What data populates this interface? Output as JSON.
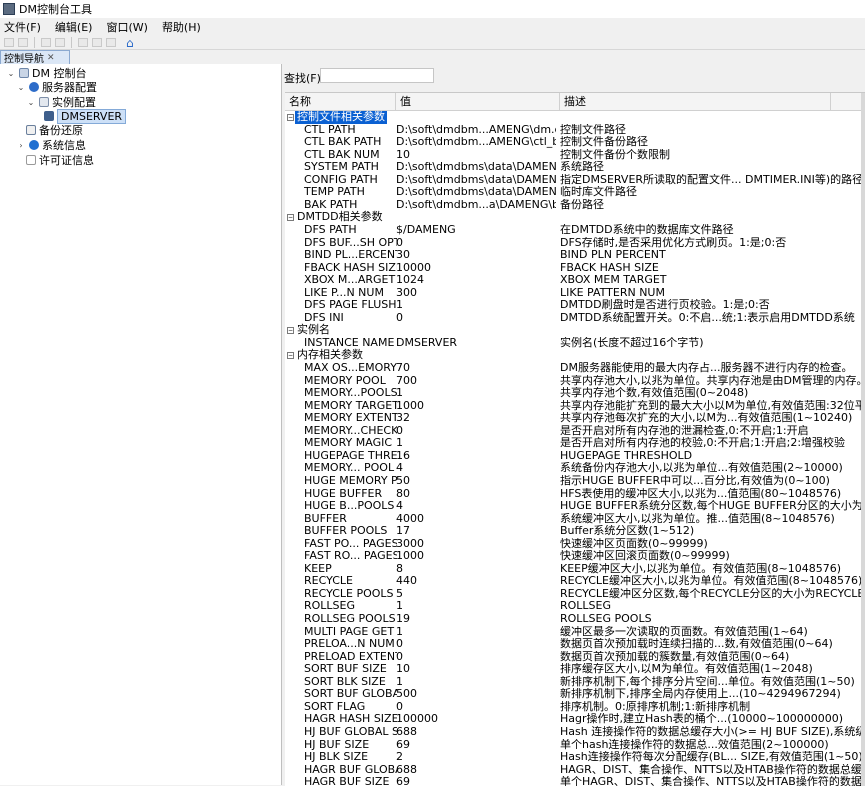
{
  "window": {
    "title": "DM控制台工具",
    "icon": "app-icon"
  },
  "menu": [
    "文件(F)",
    "编辑(E)",
    "窗口(W)",
    "帮助(H)"
  ],
  "toolbar_icons": [
    "new-icon",
    "save-icon",
    "back-icon",
    "forward-icon",
    "cut-icon",
    "copy-icon",
    "paste-icon",
    "home-icon"
  ],
  "panel": {
    "tab_label": "控制导航",
    "close_glyph": "✕"
  },
  "tree": [
    {
      "label": "DM 控制台",
      "icon": "db-icon",
      "level": 0,
      "expanded": true
    },
    {
      "label": "服务器配置",
      "icon": "gear-icon",
      "level": 1,
      "expanded": true
    },
    {
      "label": "实例配置",
      "icon": "doc-icon",
      "level": 2,
      "expanded": true
    },
    {
      "label": "DMSERVER",
      "icon": "server-icon",
      "level": 3,
      "selected": true
    },
    {
      "label": "备份还原",
      "icon": "backup-icon",
      "level": 1
    },
    {
      "label": "系统信息",
      "icon": "info-icon",
      "level": 1,
      "collapsed": true
    },
    {
      "label": "许可证信息",
      "icon": "license-icon",
      "level": 1
    }
  ],
  "search": {
    "label": "查找(F):",
    "value": ""
  },
  "table": {
    "headers": [
      "名称",
      "值",
      "描述"
    ],
    "rows": [
      {
        "group": "控制文件相关参数",
        "highlight": true
      },
      {
        "name": "CTL PATH",
        "value": "D:\\soft\\dmdbm...AMENG\\dm.ctl",
        "desc": "控制文件路径"
      },
      {
        "name": "CTL BAK PATH",
        "value": "D:\\soft\\dmdbm...AMENG\\ctl_bak",
        "desc": "控制文件备份路径"
      },
      {
        "name": "CTL BAK NUM",
        "value": "10",
        "desc": "控制文件备份个数限制"
      },
      {
        "name": "SYSTEM PATH",
        "value": "D:\\soft\\dmdbms\\data\\DAMENG",
        "desc": "系统路径"
      },
      {
        "name": "CONFIG PATH",
        "value": "D:\\soft\\dmdbms\\data\\DAMENG",
        "desc": "指定DMSERVER所读取的配置文件... DMTIMER.INI等)的路径"
      },
      {
        "name": "TEMP PATH",
        "value": "D:\\soft\\dmdbms\\data\\DAMENG",
        "desc": "临时库文件路径"
      },
      {
        "name": "BAK PATH",
        "value": "D:\\soft\\dmdbm...a\\DAMENG\\bak",
        "desc": "备份路径"
      },
      {
        "group": "DMTDD相关参数"
      },
      {
        "name": "DFS PATH",
        "value": "$/DAMENG",
        "desc": "在DMTDD系统中的数据库文件路径"
      },
      {
        "name": "DFS BUF...SH OPT",
        "value": "0",
        "desc": "DFS存储时,是否采用优化方式刷页。1:是;0:否"
      },
      {
        "name": "BIND PL...ERCENT",
        "value": "30",
        "desc": "BIND PLN PERCENT"
      },
      {
        "name": "FBACK HASH SIZE",
        "value": "10000",
        "desc": "FBACK HASH SIZE"
      },
      {
        "name": "XBOX M...ARGET",
        "value": "1024",
        "desc": "XBOX MEM TARGET"
      },
      {
        "name": "LIKE P...N NUM",
        "value": "300",
        "desc": "LIKE PATTERN NUM"
      },
      {
        "name": "DFS PAGE FLUSH",
        "value": "1",
        "desc": "DMTDD刷盘时是否进行页校验。1:是;0:否"
      },
      {
        "name": "DFS INI",
        "value": "0",
        "desc": "DMTDD系统配置开关。0:不启...统;1:表示启用DMTDD系统"
      },
      {
        "group": "实例名"
      },
      {
        "name": "INSTANCE NAME",
        "value": "DMSERVER",
        "desc": "实例名(长度不超过16个字节)"
      },
      {
        "group": "内存相关参数"
      },
      {
        "name": "MAX OS...EMORY",
        "value": "70",
        "desc": "DM服务器能使用的最大内存占...服务器不进行内存的检查。"
      },
      {
        "name": "MEMORY POOL",
        "value": "700",
        "desc": "共享内存池大小,以兆为单位。共享内存池是由DM管理的内存。"
      },
      {
        "name": "MEMORY...POOLS",
        "value": "1",
        "desc": "共享内存池个数,有效值范围(0~2048)"
      },
      {
        "name": "MEMORY TARGET",
        "value": "1000",
        "desc": "共享内存池能扩充到的最大大小以M为单位,有效值范围:32位平"
      },
      {
        "name": "MEMORY EXTENT",
        "value": "32",
        "desc": "共享内存池每次扩充的大小,以M为...有效值范围(1~10240)"
      },
      {
        "name": "MEMORY...CHECK",
        "value": "0",
        "desc": "是否开启对所有内存池的泄漏检查,0:不开启;1:开启"
      },
      {
        "name": "MEMORY MAGIC",
        "value": "1",
        "desc": "是否开启对所有内存池的校验,0:不开启;1:开启;2:增强校验"
      },
      {
        "name": "HUGEPAGE THRES",
        "value": "16",
        "desc": "HUGEPAGE THRESHOLD"
      },
      {
        "name": "MEMORY... POOL",
        "value": "4",
        "desc": "系统备份内存池大小,以兆为单位...有效值范围(2~10000)"
      },
      {
        "name": "HUGE MEMORY P",
        "value": "50",
        "desc": "指示HUGE BUFFER中可以...百分比,有效值为(0~100)"
      },
      {
        "name": "HUGE BUFFER",
        "value": "80",
        "desc": "HFS表使用的缓冲区大小,以兆为...值范围(80~1048576)"
      },
      {
        "name": "HUGE B...POOLS",
        "value": "4",
        "desc": "HUGE BUFFER系统分区数,每个HUGE BUFFER分区的大小为H"
      },
      {
        "name": "BUFFER",
        "value": "4000",
        "desc": "系统缓冲区大小,以兆为单位。推...值范围(8~1048576)"
      },
      {
        "name": "BUFFER POOLS",
        "value": "17",
        "desc": "Buffer系统分区数(1~512)"
      },
      {
        "name": "FAST PO... PAGES",
        "value": "3000",
        "desc": "快速缓冲区页面数(0~99999)"
      },
      {
        "name": "FAST RO... PAGES",
        "value": "1000",
        "desc": "快速缓冲区回滚页面数(0~99999)"
      },
      {
        "name": "KEEP",
        "value": "8",
        "desc": "KEEP缓冲区大小,以兆为单位。有效值范围(8~1048576)"
      },
      {
        "name": "RECYCLE",
        "value": "440",
        "desc": "RECYCLE缓冲区大小,以兆为单位。有效值范围(8~1048576)"
      },
      {
        "name": "RECYCLE POOLS",
        "value": "5",
        "desc": "RECYCLE缓冲区分区数,每个RECYCLE分区的大小为RECYCLE/"
      },
      {
        "name": "ROLLSEG",
        "value": "1",
        "desc": "ROLLSEG"
      },
      {
        "name": "ROLLSEG POOLS",
        "value": "19",
        "desc": "ROLLSEG POOLS"
      },
      {
        "name": "MULTI PAGE GET",
        "value": "1",
        "desc": "缓冲区最多一次读取的页面数。有效值范围(1~64)"
      },
      {
        "name": "PRELOA...N NUM",
        "value": "0",
        "desc": "数据页首次预加载时连续扫描的...数,有效值范围(0~64)"
      },
      {
        "name": "PRELOAD EXTENT",
        "value": "0",
        "desc": "数据页首次预加载的簇数量,有效值范围(0~64)"
      },
      {
        "name": "SORT BUF SIZE",
        "value": "10",
        "desc": "排序缓存区大小,以M为单位。有效值范围(1~2048)"
      },
      {
        "name": "SORT BLK SIZE",
        "value": "1",
        "desc": "新排序机制下,每个排序分片空间...单位。有效值范围(1~50)"
      },
      {
        "name": "SORT BUF GLOBAL",
        "value": "500",
        "desc": "新排序机制下,排序全局内存使用上...(10~4294967294)"
      },
      {
        "name": "SORT FLAG",
        "value": "0",
        "desc": "排序机制。0:原排序机制;1:新排序机制"
      },
      {
        "name": "HAGR HASH SIZE",
        "value": "100000",
        "desc": "Hagr操作时,建立Hash表的桶个...(10000~100000000)"
      },
      {
        "name": "HJ BUF GLOBAL SI",
        "value": "688",
        "desc": "Hash 连接操作符的数据总缓存大小(>= HJ BUF SIZE),系统级"
      },
      {
        "name": "HJ BUF SIZE",
        "value": "69",
        "desc": "单个hash连接操作符的数据总...效值范围(2~100000)"
      },
      {
        "name": "HJ BLK SIZE",
        "value": "2",
        "desc": "Hash连接操作符每次分配缓存(BL... SIZE,有效值范围(1~50)"
      },
      {
        "name": "HAGR BUF GLOBA",
        "value": "688",
        "desc": "HAGR、DIST、集合操作、NTTS以及HTAB操作符的数据总缓"
      },
      {
        "name": "HAGR BUF SIZE",
        "value": "69",
        "desc": "单个HAGR、DIST、集合操作、NTTS以及HTAB操作符的数据总"
      }
    ]
  },
  "colors": {
    "highlight": "#0a60d2",
    "selection": "#cde0f7",
    "accent": "#2d6cc9"
  }
}
